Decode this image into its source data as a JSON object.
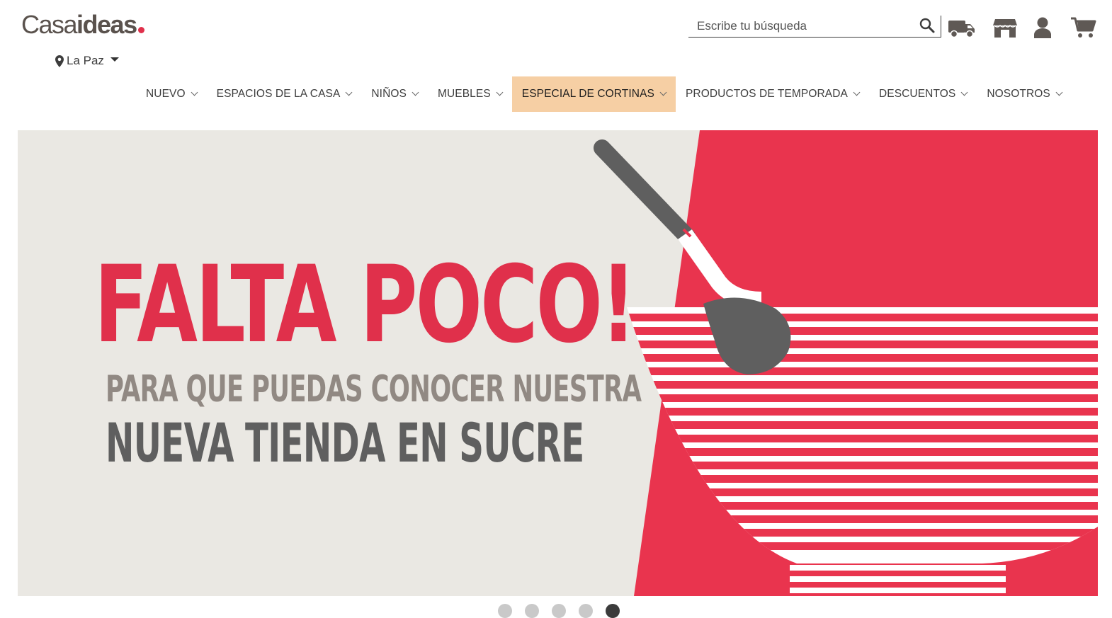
{
  "brand": {
    "part1": "Casa",
    "part2": "ideas"
  },
  "location": {
    "label": "La Paz"
  },
  "search": {
    "placeholder": "Escribe tu búsqueda"
  },
  "header_icons": [
    "truck-icon",
    "store-icon",
    "user-icon",
    "cart-icon"
  ],
  "nav": {
    "items": [
      {
        "label": "NUEVO"
      },
      {
        "label": "ESPACIOS DE LA CASA"
      },
      {
        "label": "NIÑOS"
      },
      {
        "label": "MUEBLES"
      },
      {
        "label": "ESPECIAL DE CORTINAS",
        "active": true
      },
      {
        "label": "PRODUCTOS DE TEMPORADA"
      },
      {
        "label": "DESCUENTOS"
      },
      {
        "label": "NOSOTROS"
      }
    ]
  },
  "banner": {
    "headline": "FALTA POCO!",
    "subline1": "PARA QUE PUEDAS CONOCER NUESTRA",
    "subline2": "NUEVA TIENDA EN SUCRE"
  },
  "carousel": {
    "active_index": 5,
    "count": 5
  },
  "colors": {
    "accent": "#e0304b",
    "nav_active": "#f6cfa4",
    "banner_bg": "#eae8e3",
    "text": "#3d3d3d"
  }
}
